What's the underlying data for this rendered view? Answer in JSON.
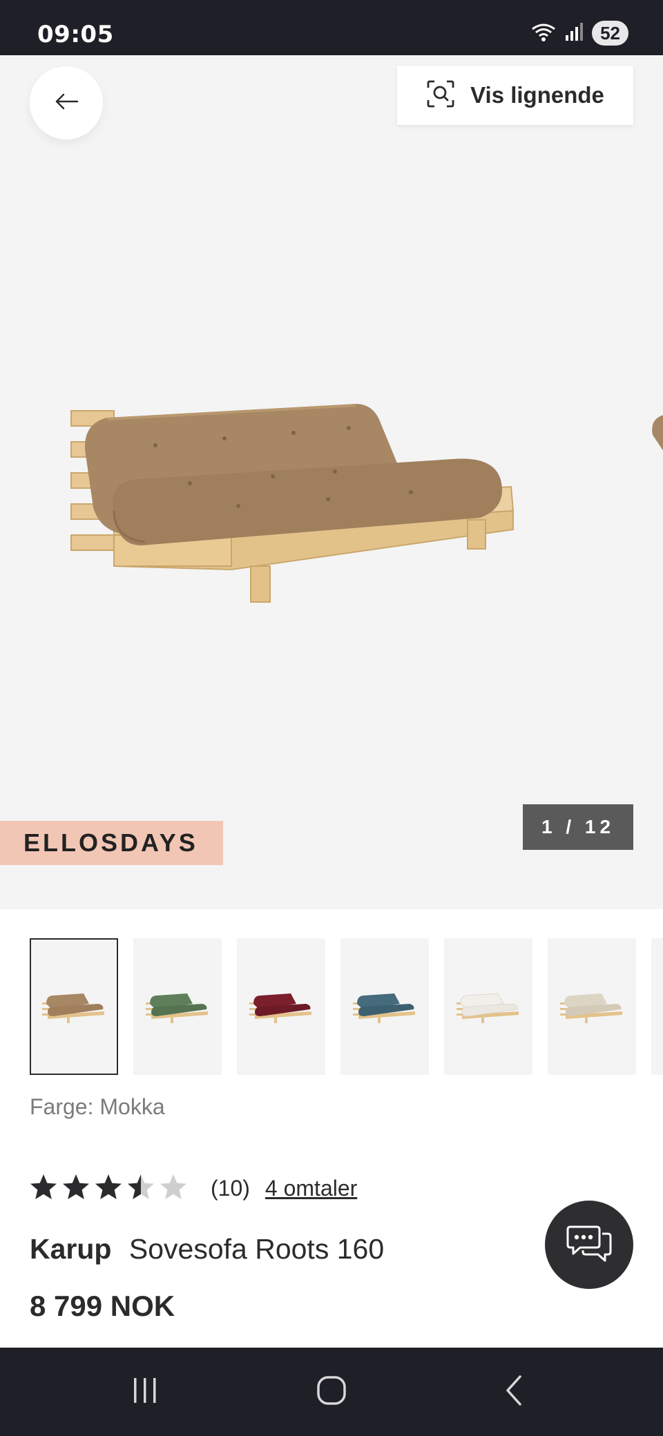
{
  "status_bar": {
    "time": "09:05",
    "battery": "52",
    "wifi_icon": "wifi-icon",
    "signal_icon": "signal-icon"
  },
  "hero": {
    "back_icon": "arrow-left-icon",
    "similar_button_label": "Vis lignende",
    "similar_icon": "visual-search-icon",
    "promo_badge": "ELLOSDAYS",
    "image_counter": "1 / 12"
  },
  "thumbnails": [
    {
      "color_name": "Mokka",
      "cushion": "#a88764",
      "selected": true
    },
    {
      "color_name": "green",
      "cushion": "#5f7f5a",
      "selected": false
    },
    {
      "color_name": "burgundy",
      "cushion": "#7a1f2b",
      "selected": false
    },
    {
      "color_name": "blue",
      "cushion": "#456b7d",
      "selected": false
    },
    {
      "color_name": "white",
      "cushion": "#f1efe9",
      "selected": false
    },
    {
      "color_name": "beige",
      "cushion": "#ddd5c4",
      "selected": false
    }
  ],
  "product": {
    "color_label": "Farge: Mokka",
    "rating_value": 3.5,
    "rating_count": "(10)",
    "reviews_link": "4 omtaler",
    "brand": "Karup",
    "name": "Sovesofa Roots 160",
    "price": "8 799 NOK"
  },
  "chat": {
    "icon": "chat-bubbles-icon"
  },
  "nav_bar": {
    "recent_icon": "recent-apps-icon",
    "home_icon": "home-icon",
    "back_icon": "back-chevron-icon"
  },
  "colors": {
    "status_bar_bg": "#1f2027",
    "promo_badge_bg": "#f2c6b4",
    "counter_bg": "#5a5a5a",
    "wood": "#e8cc9a",
    "cushion_selected": "#a88764"
  }
}
